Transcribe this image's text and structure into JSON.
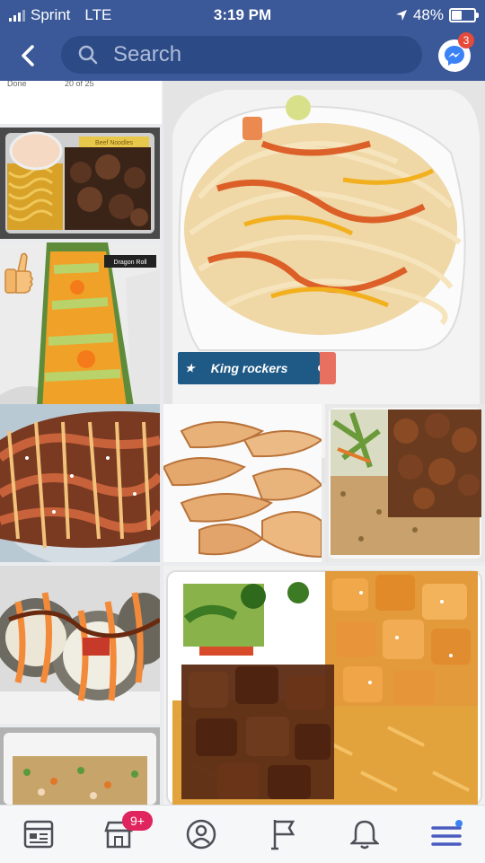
{
  "status_bar": {
    "carrier": "Sprint",
    "network": "LTE",
    "time": "3:19 PM",
    "battery": "48%"
  },
  "nav": {
    "search_placeholder": "Search",
    "messenger_badge": "3"
  },
  "photos": [
    {
      "name": "photo-beef-noodles",
      "label": "Beef Noodles"
    },
    {
      "name": "photo-noodles-large",
      "caption": "King rockers"
    },
    {
      "name": "photo-dragon-roll",
      "label": "Dragon Roll"
    },
    {
      "name": "photo-sushi-roll-sauce"
    },
    {
      "name": "photo-dumplings"
    },
    {
      "name": "photo-chicken-rice"
    },
    {
      "name": "photo-tempura-roll"
    },
    {
      "name": "photo-fried-rice"
    },
    {
      "name": "photo-steak-chicken-rice"
    }
  ],
  "top_strip": {
    "left_text": "Done",
    "center_text": "20 of 25"
  },
  "tabs": [
    {
      "name": "tab-news-feed",
      "icon": "news-feed-icon"
    },
    {
      "name": "tab-marketplace",
      "icon": "marketplace-icon",
      "badge": "9+"
    },
    {
      "name": "tab-profile",
      "icon": "profile-icon"
    },
    {
      "name": "tab-pages",
      "icon": "flag-icon"
    },
    {
      "name": "tab-notifications",
      "icon": "bell-icon"
    },
    {
      "name": "tab-menu",
      "icon": "menu-icon"
    }
  ],
  "colors": {
    "brand": "#3b5998",
    "badge": "#e0245e",
    "menu_accent": "#4a5bbf"
  }
}
